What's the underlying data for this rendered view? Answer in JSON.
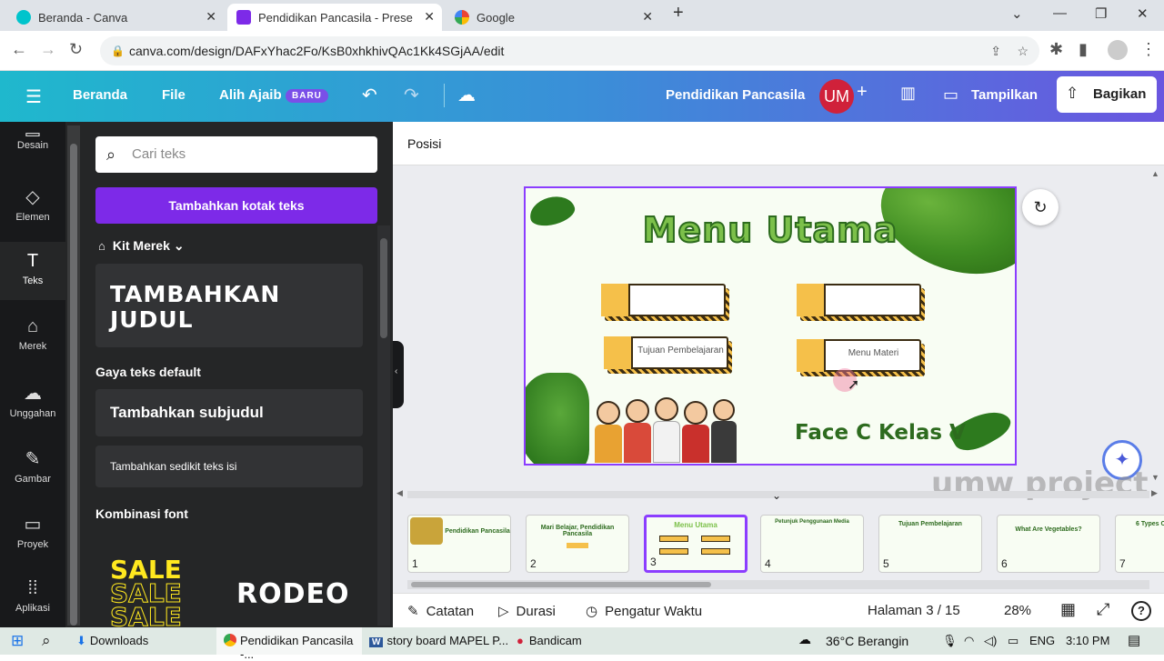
{
  "browser": {
    "tabs": [
      {
        "title": "Beranda - Canva"
      },
      {
        "title": "Pendidikan Pancasila - Presentas"
      },
      {
        "title": "Google"
      }
    ],
    "url": "canva.com/design/DAFxYhac2Fo/KsB0xhkhivQAc1Kk4SGjAA/edit"
  },
  "header": {
    "beranda": "Beranda",
    "file": "File",
    "alih_ajaib": "Alih Ajaib",
    "baru": "BARU",
    "design_title": "Pendidikan Pancasila",
    "avatar": "UM",
    "tampilkan": "Tampilkan",
    "bagikan": "Bagikan"
  },
  "rail": {
    "items": [
      {
        "label": "Desain",
        "icon": "layout-icon"
      },
      {
        "label": "Elemen",
        "icon": "shapes-icon"
      },
      {
        "label": "Teks",
        "icon": "text-icon"
      },
      {
        "label": "Merek",
        "icon": "brand-icon"
      },
      {
        "label": "Unggahan",
        "icon": "cloud-upload-icon"
      },
      {
        "label": "Gambar",
        "icon": "draw-icon"
      },
      {
        "label": "Proyek",
        "icon": "folder-icon"
      },
      {
        "label": "Aplikasi",
        "icon": "apps-icon"
      }
    ]
  },
  "panel": {
    "search_placeholder": "Cari teks",
    "add_textbox": "Tambahkan kotak teks",
    "kit_merek": "Kit Merek",
    "add_heading": "TAMBAHKAN JUDUL",
    "default_styles": "Gaya teks default",
    "add_subheading": "Tambahkan subjudul",
    "add_body": "Tambahkan sedikit teks isi",
    "font_combos": "Kombinasi font",
    "combo1": "SALE",
    "combo2": "RODEO"
  },
  "posbar": {
    "label": "Posisi"
  },
  "slide": {
    "title": "Menu Utama",
    "btn3": "Tujuan Pembelajaran",
    "btn4": "Menu Materi",
    "footer": "Face C Kelas V"
  },
  "watermark": "umw project",
  "thumbs": [
    {
      "n": "1",
      "t": "Pendidikan Pancasila"
    },
    {
      "n": "2",
      "t": "Mari Belajar, Pendidikan Pancasila"
    },
    {
      "n": "3",
      "t": "Menu Utama"
    },
    {
      "n": "4",
      "t": "Petunjuk Penggunaan Media"
    },
    {
      "n": "5",
      "t": "Tujuan Pembelajaran"
    },
    {
      "n": "6",
      "t": "What Are Vegetables?"
    },
    {
      "n": "7",
      "t": "6 Types O"
    }
  ],
  "bottombar": {
    "notes": "Catatan",
    "duration": "Durasi",
    "timer": "Pengatur Waktu",
    "page": "Halaman 3 / 15",
    "zoom": "28%"
  },
  "taskbar": {
    "downloads": "Downloads",
    "chrome": "Pendidikan Pancasila -...",
    "word": "story board MAPEL P...",
    "bandicam": "Bandicam",
    "weather": "36°C  Berangin",
    "lang": "ENG",
    "time": "3:10 PM"
  },
  "colors": {
    "accent": "#7d2ae8",
    "slide_green": "#2d6b1e",
    "button_yellow": "#f5c04a"
  }
}
